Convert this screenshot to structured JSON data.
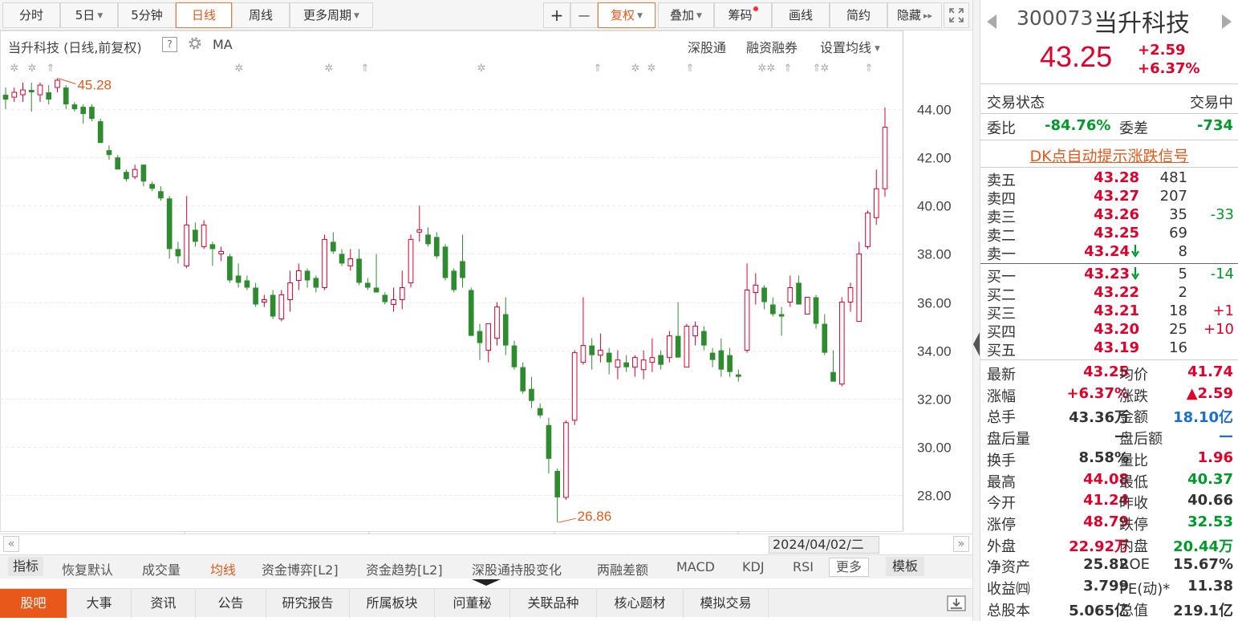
{
  "toolbar": {
    "periods": [
      {
        "label": "分时",
        "active": false
      },
      {
        "label": "5日",
        "active": false,
        "dropdown": true
      },
      {
        "label": "5分钟",
        "active": false
      },
      {
        "label": "日线",
        "active": true
      },
      {
        "label": "周线",
        "active": false
      },
      {
        "label": "更多周期",
        "active": false,
        "dropdown": true
      }
    ],
    "zoom_in": "+",
    "zoom_out": "—",
    "fuquan": "复权",
    "overlay": "叠加",
    "chips": "筹码",
    "draw": "画线",
    "simple": "简约",
    "hide": "隐藏"
  },
  "info": {
    "title": "当升科技 (日线,前复权)",
    "help": "?",
    "ma": "MA",
    "links": [
      "深股通",
      "融资融券",
      "设置均线"
    ]
  },
  "chart_data": {
    "type": "candlestick",
    "y_ticks": [
      "44.00",
      "42.00",
      "40.00",
      "38.00",
      "36.00",
      "34.00",
      "32.00",
      "30.00",
      "28.00"
    ],
    "ylim": [
      26.5,
      46.2
    ],
    "max_label": "45.28",
    "min_label": "26.86",
    "up_color": "#e0002a",
    "down_color": "#2e8b2e",
    "candles": [
      {
        "o": 44.6,
        "h": 44.9,
        "l": 44.0,
        "c": 44.4
      },
      {
        "o": 44.5,
        "h": 44.9,
        "l": 44.3,
        "c": 44.7
      },
      {
        "o": 44.6,
        "h": 45.1,
        "l": 44.3,
        "c": 44.8
      },
      {
        "o": 44.8,
        "h": 45.1,
        "l": 43.9,
        "c": 44.7
      },
      {
        "o": 44.6,
        "h": 45.1,
        "l": 44.3,
        "c": 45.0
      },
      {
        "o": 44.7,
        "h": 45.0,
        "l": 44.2,
        "c": 44.4
      },
      {
        "o": 44.9,
        "h": 45.28,
        "l": 44.7,
        "c": 45.2
      },
      {
        "o": 44.9,
        "h": 45.0,
        "l": 44.0,
        "c": 44.2
      },
      {
        "o": 44.2,
        "h": 44.3,
        "l": 43.9,
        "c": 44.0
      },
      {
        "o": 44.1,
        "h": 44.2,
        "l": 43.4,
        "c": 43.8
      },
      {
        "o": 44.1,
        "h": 44.2,
        "l": 43.5,
        "c": 43.6
      },
      {
        "o": 43.5,
        "h": 43.6,
        "l": 42.6,
        "c": 42.6
      },
      {
        "o": 42.3,
        "h": 42.5,
        "l": 41.9,
        "c": 42.1
      },
      {
        "o": 42.0,
        "h": 42.1,
        "l": 41.5,
        "c": 41.5
      },
      {
        "o": 41.4,
        "h": 41.5,
        "l": 41.0,
        "c": 41.1
      },
      {
        "o": 41.2,
        "h": 41.7,
        "l": 41.1,
        "c": 41.5
      },
      {
        "o": 41.7,
        "h": 41.7,
        "l": 40.8,
        "c": 41.0
      },
      {
        "o": 40.9,
        "h": 41.0,
        "l": 40.6,
        "c": 40.7
      },
      {
        "o": 40.6,
        "h": 40.8,
        "l": 40.2,
        "c": 40.3
      },
      {
        "o": 40.3,
        "h": 40.4,
        "l": 37.8,
        "c": 38.2
      },
      {
        "o": 38.2,
        "h": 38.5,
        "l": 37.6,
        "c": 37.9
      },
      {
        "o": 37.5,
        "h": 40.4,
        "l": 37.4,
        "c": 39.2
      },
      {
        "o": 39.0,
        "h": 39.3,
        "l": 38.3,
        "c": 38.5
      },
      {
        "o": 38.3,
        "h": 39.4,
        "l": 38.2,
        "c": 39.2
      },
      {
        "o": 38.4,
        "h": 38.5,
        "l": 37.5,
        "c": 38.2
      },
      {
        "o": 38.0,
        "h": 38.3,
        "l": 37.7,
        "c": 38.1
      },
      {
        "o": 37.9,
        "h": 38.0,
        "l": 36.8,
        "c": 36.9
      },
      {
        "o": 37.1,
        "h": 37.6,
        "l": 36.6,
        "c": 36.8
      },
      {
        "o": 36.9,
        "h": 37.1,
        "l": 36.5,
        "c": 36.6
      },
      {
        "o": 36.6,
        "h": 36.8,
        "l": 35.8,
        "c": 35.9
      },
      {
        "o": 36.0,
        "h": 36.3,
        "l": 35.8,
        "c": 36.1
      },
      {
        "o": 36.3,
        "h": 36.5,
        "l": 35.3,
        "c": 35.4
      },
      {
        "o": 35.3,
        "h": 36.5,
        "l": 35.2,
        "c": 36.3
      },
      {
        "o": 36.1,
        "h": 37.3,
        "l": 35.6,
        "c": 36.8
      },
      {
        "o": 36.9,
        "h": 37.6,
        "l": 36.5,
        "c": 37.3
      },
      {
        "o": 37.3,
        "h": 37.4,
        "l": 36.6,
        "c": 36.9
      },
      {
        "o": 37.0,
        "h": 37.1,
        "l": 36.4,
        "c": 36.6
      },
      {
        "o": 36.6,
        "h": 38.8,
        "l": 36.5,
        "c": 38.6
      },
      {
        "o": 38.5,
        "h": 38.9,
        "l": 38.0,
        "c": 38.1
      },
      {
        "o": 38.0,
        "h": 38.2,
        "l": 37.5,
        "c": 37.6
      },
      {
        "o": 37.5,
        "h": 38.2,
        "l": 37.3,
        "c": 37.8
      },
      {
        "o": 37.8,
        "h": 38.2,
        "l": 36.7,
        "c": 36.8
      },
      {
        "o": 36.8,
        "h": 37.0,
        "l": 36.5,
        "c": 36.6
      },
      {
        "o": 36.6,
        "h": 38.0,
        "l": 36.5,
        "c": 36.4
      },
      {
        "o": 36.3,
        "h": 36.4,
        "l": 35.9,
        "c": 36.0
      },
      {
        "o": 35.9,
        "h": 36.6,
        "l": 35.6,
        "c": 36.1
      },
      {
        "o": 36.1,
        "h": 37.3,
        "l": 35.7,
        "c": 36.6
      },
      {
        "o": 36.8,
        "h": 38.8,
        "l": 36.6,
        "c": 38.6
      },
      {
        "o": 38.9,
        "h": 40.0,
        "l": 38.5,
        "c": 39.0
      },
      {
        "o": 38.8,
        "h": 39.1,
        "l": 38.3,
        "c": 38.4
      },
      {
        "o": 38.7,
        "h": 38.9,
        "l": 37.8,
        "c": 37.9
      },
      {
        "o": 38.3,
        "h": 38.4,
        "l": 36.9,
        "c": 37.0
      },
      {
        "o": 37.3,
        "h": 37.4,
        "l": 36.4,
        "c": 36.5
      },
      {
        "o": 37.7,
        "h": 38.8,
        "l": 36.6,
        "c": 37.0
      },
      {
        "o": 36.5,
        "h": 36.6,
        "l": 34.6,
        "c": 34.6
      },
      {
        "o": 34.8,
        "h": 35.1,
        "l": 33.6,
        "c": 34.3
      },
      {
        "o": 34.0,
        "h": 35.0,
        "l": 33.5,
        "c": 35.1
      },
      {
        "o": 34.5,
        "h": 36.0,
        "l": 34.2,
        "c": 35.8
      },
      {
        "o": 35.5,
        "h": 36.2,
        "l": 33.8,
        "c": 34.2
      },
      {
        "o": 34.2,
        "h": 34.4,
        "l": 33.2,
        "c": 33.3
      },
      {
        "o": 33.3,
        "h": 33.5,
        "l": 32.2,
        "c": 32.3
      },
      {
        "o": 32.4,
        "h": 32.9,
        "l": 31.6,
        "c": 31.9
      },
      {
        "o": 31.6,
        "h": 31.8,
        "l": 31.2,
        "c": 31.3
      },
      {
        "o": 30.9,
        "h": 31.2,
        "l": 28.9,
        "c": 29.5
      },
      {
        "o": 29.0,
        "h": 29.1,
        "l": 26.86,
        "c": 27.9
      },
      {
        "o": 27.9,
        "h": 31.1,
        "l": 27.8,
        "c": 31.0
      },
      {
        "o": 31.1,
        "h": 34.0,
        "l": 30.9,
        "c": 33.9
      },
      {
        "o": 33.5,
        "h": 36.2,
        "l": 33.4,
        "c": 34.2
      },
      {
        "o": 34.2,
        "h": 34.5,
        "l": 33.2,
        "c": 33.8
      },
      {
        "o": 33.8,
        "h": 34.7,
        "l": 33.5,
        "c": 34.0
      },
      {
        "o": 33.9,
        "h": 34.1,
        "l": 33.0,
        "c": 33.5
      },
      {
        "o": 33.3,
        "h": 34.0,
        "l": 32.8,
        "c": 33.6
      },
      {
        "o": 33.5,
        "h": 33.8,
        "l": 33.1,
        "c": 33.3
      },
      {
        "o": 33.3,
        "h": 33.8,
        "l": 32.9,
        "c": 33.7
      },
      {
        "o": 33.2,
        "h": 34.0,
        "l": 32.8,
        "c": 33.6
      },
      {
        "o": 33.5,
        "h": 34.5,
        "l": 33.1,
        "c": 33.7
      },
      {
        "o": 33.8,
        "h": 34.0,
        "l": 33.2,
        "c": 33.4
      },
      {
        "o": 33.7,
        "h": 34.8,
        "l": 33.5,
        "c": 34.6
      },
      {
        "o": 34.6,
        "h": 36.0,
        "l": 33.7,
        "c": 33.7
      },
      {
        "o": 33.3,
        "h": 35.1,
        "l": 33.3,
        "c": 35.0
      },
      {
        "o": 34.6,
        "h": 35.2,
        "l": 34.2,
        "c": 35.0
      },
      {
        "o": 34.8,
        "h": 35.0,
        "l": 34.0,
        "c": 34.2
      },
      {
        "o": 33.9,
        "h": 34.1,
        "l": 33.3,
        "c": 33.6
      },
      {
        "o": 34.0,
        "h": 34.5,
        "l": 32.9,
        "c": 33.2
      },
      {
        "o": 33.8,
        "h": 34.1,
        "l": 32.9,
        "c": 33.1
      },
      {
        "o": 33.0,
        "h": 33.2,
        "l": 32.7,
        "c": 32.9
      },
      {
        "o": 34.0,
        "h": 37.6,
        "l": 33.9,
        "c": 36.5
      },
      {
        "o": 36.4,
        "h": 37.2,
        "l": 35.9,
        "c": 36.7
      },
      {
        "o": 36.6,
        "h": 36.7,
        "l": 35.7,
        "c": 36.0
      },
      {
        "o": 35.9,
        "h": 36.2,
        "l": 35.4,
        "c": 35.5
      },
      {
        "o": 35.5,
        "h": 35.8,
        "l": 34.6,
        "c": 35.4
      },
      {
        "o": 36.0,
        "h": 37.1,
        "l": 35.8,
        "c": 36.6
      },
      {
        "o": 36.8,
        "h": 37.1,
        "l": 35.9,
        "c": 35.9
      },
      {
        "o": 35.5,
        "h": 36.2,
        "l": 35.6,
        "c": 36.2
      },
      {
        "o": 36.2,
        "h": 36.3,
        "l": 34.9,
        "c": 35.1
      },
      {
        "o": 35.1,
        "h": 35.5,
        "l": 33.8,
        "c": 33.9
      },
      {
        "o": 33.1,
        "h": 34.0,
        "l": 32.8,
        "c": 32.7
      },
      {
        "o": 32.6,
        "h": 36.2,
        "l": 32.5,
        "c": 36.0
      },
      {
        "o": 36.0,
        "h": 36.8,
        "l": 35.6,
        "c": 36.6
      },
      {
        "o": 35.2,
        "h": 38.5,
        "l": 35.2,
        "c": 38.0
      },
      {
        "o": 38.3,
        "h": 39.8,
        "l": 38.2,
        "c": 39.7
      },
      {
        "o": 39.5,
        "h": 41.5,
        "l": 39.2,
        "c": 40.7
      },
      {
        "o": 40.7,
        "h": 44.08,
        "l": 40.37,
        "c": 43.25
      }
    ]
  },
  "scroll": {
    "left": "«",
    "right": "»",
    "date": "2024/04/02/二"
  },
  "indicators": {
    "first": "指标",
    "items": [
      "恢复默认",
      "成交量",
      "均线",
      "资金博弈[L2]",
      "资金趋势[L2]",
      "深股通持股变化",
      "两融差额",
      "MACD",
      "KDJ",
      "RSI"
    ],
    "active": "均线",
    "more": "更多",
    "template": "模板"
  },
  "tabs": [
    "股吧",
    "大事",
    "资讯",
    "公告",
    "研究报告",
    "所属板块",
    "问董秘",
    "关联品种",
    "核心题材",
    "模拟交易"
  ],
  "stock": {
    "code": "300073",
    "name": "当升科技",
    "price": "43.25",
    "change": "+2.59",
    "change_pct": "+6.37%"
  },
  "trade": {
    "status_label": "交易状态",
    "status": "交易中",
    "weibi_label": "委比",
    "weibi": "-84.76%",
    "weicha_label": "委差",
    "weicha": "-734"
  },
  "dk_link": "DK点自动提示涨跌信号",
  "orderbook": {
    "asks": [
      {
        "label": "卖五",
        "price": "43.28",
        "vol": "481",
        "delta": ""
      },
      {
        "label": "卖四",
        "price": "43.27",
        "vol": "207",
        "delta": ""
      },
      {
        "label": "卖三",
        "price": "43.26",
        "vol": "35",
        "delta": "-33"
      },
      {
        "label": "卖二",
        "price": "43.25",
        "vol": "69",
        "delta": ""
      },
      {
        "label": "卖一",
        "price": "43.24",
        "vol": "8",
        "delta": "",
        "arrow": true
      }
    ],
    "bids": [
      {
        "label": "买一",
        "price": "43.23",
        "vol": "5",
        "delta": "-14",
        "arrow": true
      },
      {
        "label": "买二",
        "price": "43.22",
        "vol": "2",
        "delta": ""
      },
      {
        "label": "买三",
        "price": "43.21",
        "vol": "18",
        "delta": "+1"
      },
      {
        "label": "买四",
        "price": "43.20",
        "vol": "25",
        "delta": "+10"
      },
      {
        "label": "买五",
        "price": "43.19",
        "vol": "16",
        "delta": ""
      }
    ]
  },
  "quote": [
    {
      "l1": "最新",
      "v1": "43.25",
      "c1": "red",
      "l2": "均价",
      "v2": "41.74",
      "c2": "red"
    },
    {
      "l1": "涨幅",
      "v1": "+6.37%",
      "c1": "red",
      "l2": "涨跌",
      "v2": "▲2.59",
      "c2": "red"
    },
    {
      "l1": "总手",
      "v1": "43.36万",
      "c1": "dark",
      "l2": "金额",
      "v2": "18.10亿",
      "c2": "blue"
    },
    {
      "l1": "盘后量",
      "v1": "—",
      "c1": "dark",
      "l2": "盘后额",
      "v2": "—",
      "c2": "blue"
    },
    {
      "l1": "换手",
      "v1": "8.58%",
      "c1": "dark",
      "l2": "量比",
      "v2": "1.96",
      "c2": "red"
    },
    {
      "l1": "最高",
      "v1": "44.08",
      "c1": "red",
      "l2": "最低",
      "v2": "40.37",
      "c2": "green"
    },
    {
      "l1": "今开",
      "v1": "41.24",
      "c1": "red",
      "l2": "昨收",
      "v2": "40.66",
      "c2": "dark"
    },
    {
      "l1": "涨停",
      "v1": "48.79",
      "c1": "red",
      "l2": "跌停",
      "v2": "32.53",
      "c2": "green"
    },
    {
      "l1": "外盘",
      "v1": "22.92万",
      "c1": "red",
      "l2": "内盘",
      "v2": "20.44万",
      "c2": "green"
    },
    {
      "l1": "净资产",
      "v1": "25.82",
      "c1": "dark",
      "l2": "ROE",
      "v2": "15.67%",
      "c2": "dark"
    },
    {
      "l1": "收益㈣",
      "v1": "3.799",
      "c1": "dark",
      "l2": "PE(动)*",
      "v2": "11.38",
      "c2": "dark"
    },
    {
      "l1": "总股本",
      "v1": "5.065亿",
      "c1": "dark",
      "l2": "总值",
      "v2": "219.1亿",
      "c2": "dark"
    }
  ]
}
